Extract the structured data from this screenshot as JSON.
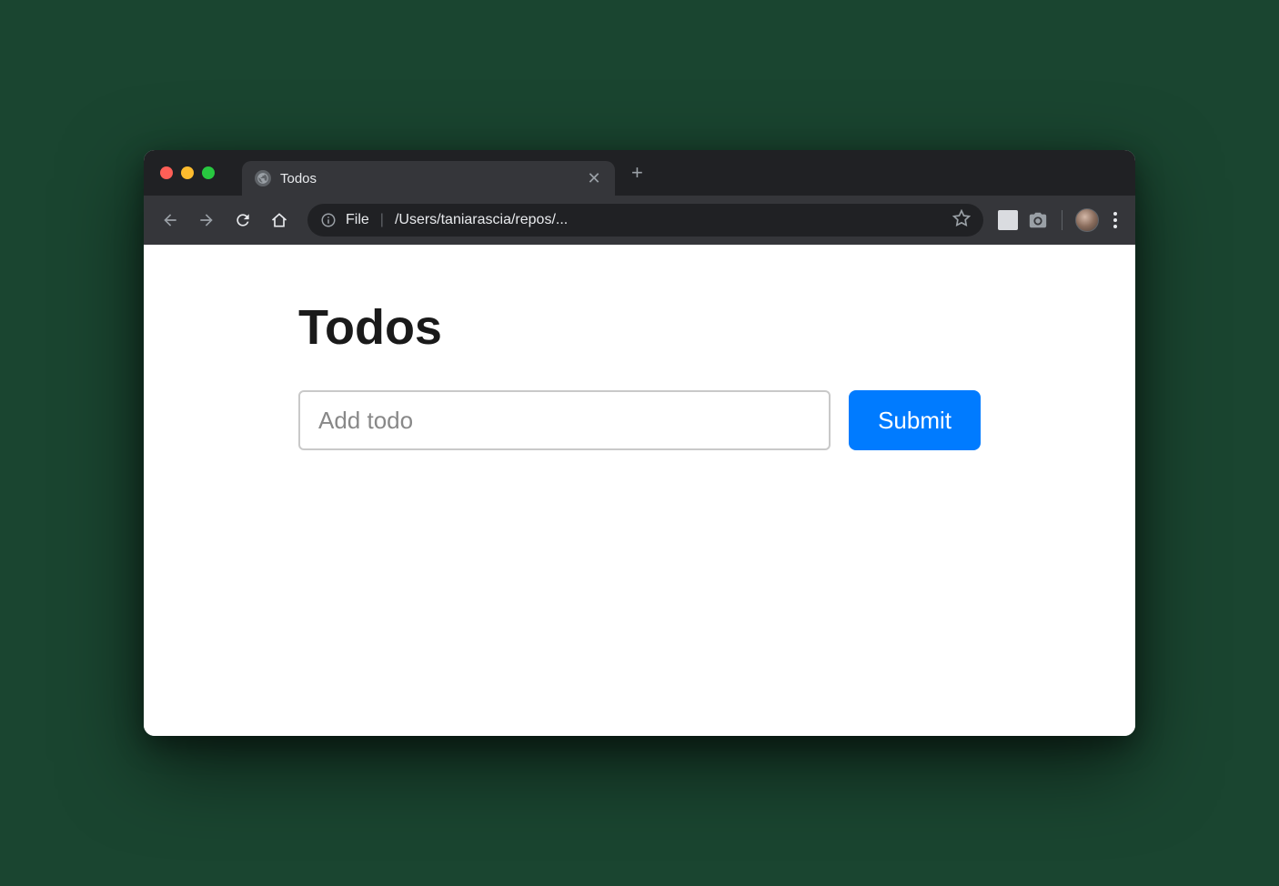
{
  "browser": {
    "tab": {
      "title": "Todos"
    },
    "url": {
      "scheme": "File",
      "path": "/Users/taniarascia/repos/..."
    }
  },
  "page": {
    "heading": "Todos",
    "input": {
      "placeholder": "Add todo",
      "value": ""
    },
    "submit_label": "Submit"
  },
  "colors": {
    "primary": "#007bff"
  }
}
